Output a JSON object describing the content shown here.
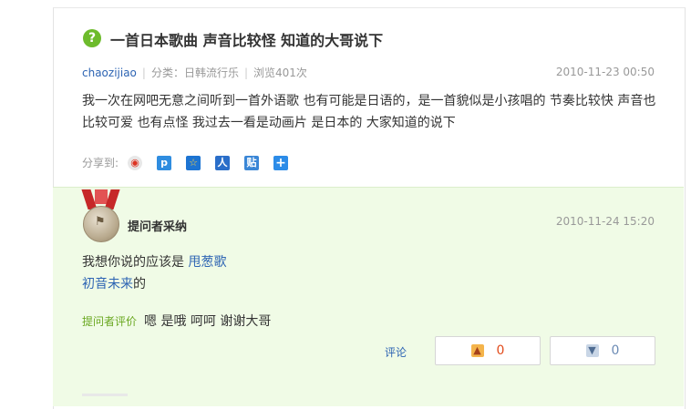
{
  "question": {
    "icon": "question-icon",
    "title": "一首日本歌曲 声音比较怪 知道的大哥说下",
    "user": "chaozijiao",
    "category_label": "分类：",
    "category": "日韩流行乐",
    "views": "浏览401次",
    "time": "2010-11-23 00:50",
    "body": "我一次在网吧无意之间听到一首外语歌 也有可能是日语的，是一首貌似是小孩唱的 节奏比较快 声音也比较可爱  也有点怪  我过去一看是动画片   是日本的  大家知道的说下"
  },
  "share": {
    "label": "分享到:",
    "icons": [
      "weibo-icon",
      "qzone-icon",
      "qq-icon",
      "renren-icon",
      "tieba-icon",
      "more-icon"
    ],
    "glyphs": [
      "◉",
      "p",
      "☆",
      "人",
      "贴",
      "+"
    ]
  },
  "answer": {
    "badge": "提问者采纳",
    "time": "2010-11-24 15:20",
    "line1_prefix": "我想你说的应该是 ",
    "line1_link": "甩葱歌",
    "line2_link": "初音未来",
    "line2_suffix": "的",
    "eval_label": "提问者评价",
    "eval_text": "嗯 是哦  呵呵  谢谢大哥",
    "comment": "评论",
    "up_count": "0",
    "down_count": "0"
  },
  "colors": {
    "accent_green": "#6dbb2c",
    "link_blue": "#2d64b3",
    "answer_bg": "#f0fbe6",
    "up_red": "#e24b1b"
  }
}
